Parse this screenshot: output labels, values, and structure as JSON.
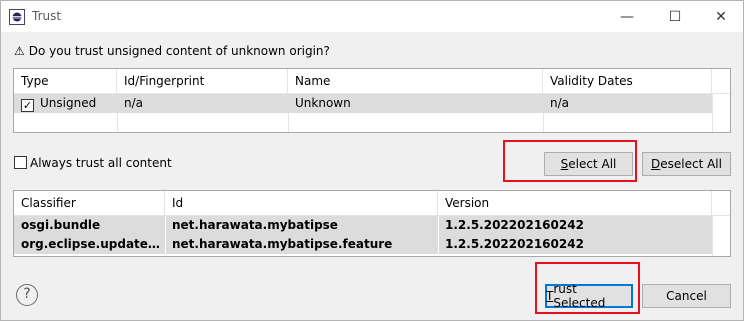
{
  "window": {
    "title": "Trust",
    "minimize_glyph": "—",
    "maximize_glyph": "☐",
    "close_glyph": "✕"
  },
  "question": {
    "icon": "⚠",
    "text": "Do you trust unsigned content of unknown origin?"
  },
  "signer_table": {
    "columns": [
      "Type",
      "Id/Fingerprint",
      "Name",
      "Validity Dates"
    ],
    "rows": [
      {
        "type": "Unsigned",
        "id": "n/a",
        "name": "Unknown",
        "validity": "n/a",
        "checked": "✓"
      }
    ]
  },
  "always_trust": {
    "label": "Always trust all content"
  },
  "buttons": {
    "select_all_mnemonic": "S",
    "select_all_rest": "elect All",
    "deselect_all_mnemonic": "D",
    "deselect_all_rest": "eselect All",
    "trust_selected_mnemonic": "T",
    "trust_selected_rest": "rust Selected",
    "cancel": "Cancel",
    "help_glyph": "?"
  },
  "artifact_table": {
    "columns": [
      "Classifier",
      "Id",
      "Version"
    ],
    "rows": [
      {
        "classifier": "osgi.bundle",
        "id": "net.harawata.mybatipse",
        "version": "1.2.5.202202160242"
      },
      {
        "classifier": "org.eclipse.update.feature",
        "id": "net.harawata.mybatipse.feature",
        "version": "1.2.5.202202160242"
      }
    ]
  },
  "colors": {
    "highlight": "#e8111b",
    "default_button_border": "#0078d7",
    "row_selected": "#dcdcdc"
  }
}
